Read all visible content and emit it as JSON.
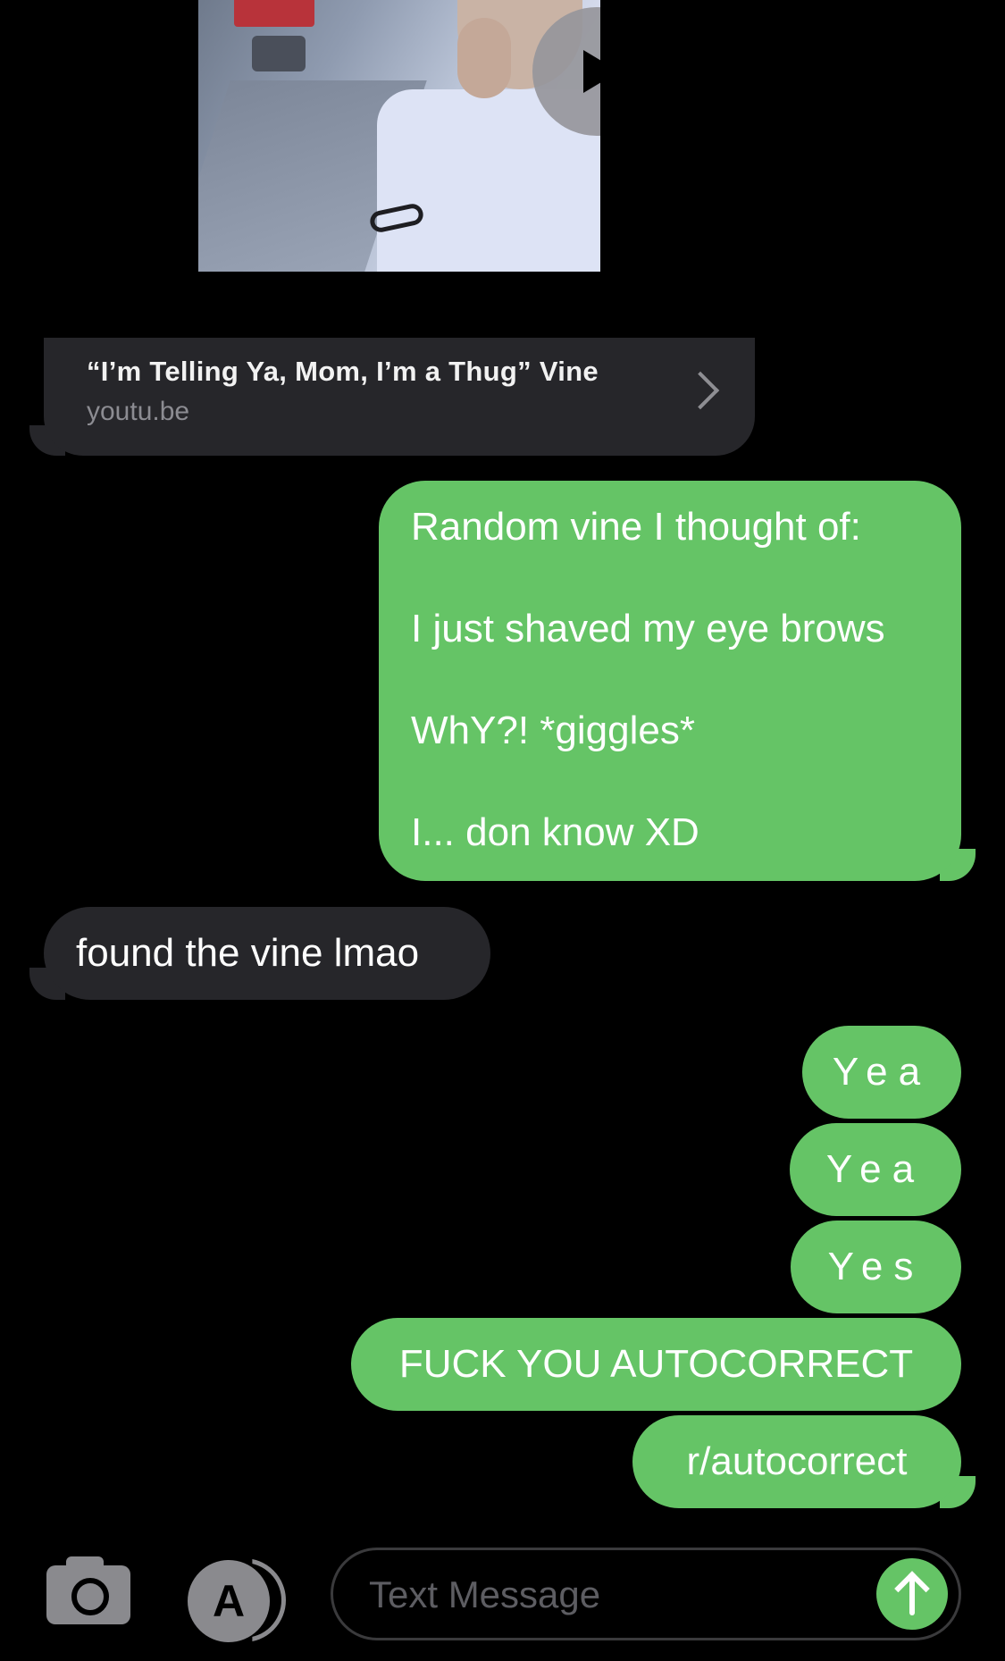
{
  "conversation": {
    "video": {
      "play_icon": "play-icon"
    },
    "link_preview": {
      "title": "“I’m Telling Ya, Mom, I’m a Thug” Vine",
      "domain": "youtu.be"
    },
    "messages": {
      "long": {
        "line1": "Random vine I thought of:",
        "line2": "I just shaved my eye brows",
        "line3": "WhY?! *giggles*",
        "line4": "I... don know XD"
      },
      "found": "found the vine lmao",
      "yea1": "Yea",
      "yea2": "Yea",
      "yes": "Yes",
      "fuck": "FUCK YOU AUTOCORRECT",
      "subreddit": "r/autocorrect"
    }
  },
  "composer": {
    "placeholder": "Text Message",
    "camera_icon": "camera-icon",
    "appstore_icon": "app-store-icon",
    "send_icon": "arrow-up-icon"
  },
  "colors": {
    "sent_bubble": "#65c466",
    "received_bubble": "#26262a",
    "background": "#000000"
  }
}
